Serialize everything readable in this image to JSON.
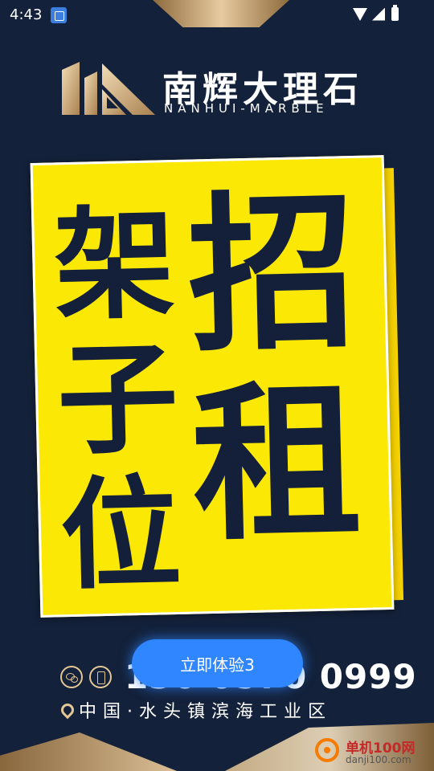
{
  "status_bar": {
    "time": "4:43"
  },
  "brand": {
    "name_cn": "南辉大理石",
    "name_en": "NANHUI-MARBLE"
  },
  "poster": {
    "headline_left": [
      "架",
      "子",
      "位"
    ],
    "headline_right": [
      "招",
      "租"
    ]
  },
  "contact": {
    "phone": "130 0570 0999",
    "address": "中国·水头镇滨海工业区"
  },
  "cta": {
    "label": "立即体验3"
  },
  "watermark": {
    "title": "单机100网",
    "url": "danji100.com"
  },
  "colors": {
    "background": "#13213a",
    "accent_yellow": "#fbe805",
    "gold": "#e4c795",
    "button_blue": "#2f86ff"
  },
  "icons": [
    "wifi-icon",
    "signal-icon",
    "battery-icon",
    "wechat-icon",
    "phone-icon",
    "location-pin-icon"
  ]
}
